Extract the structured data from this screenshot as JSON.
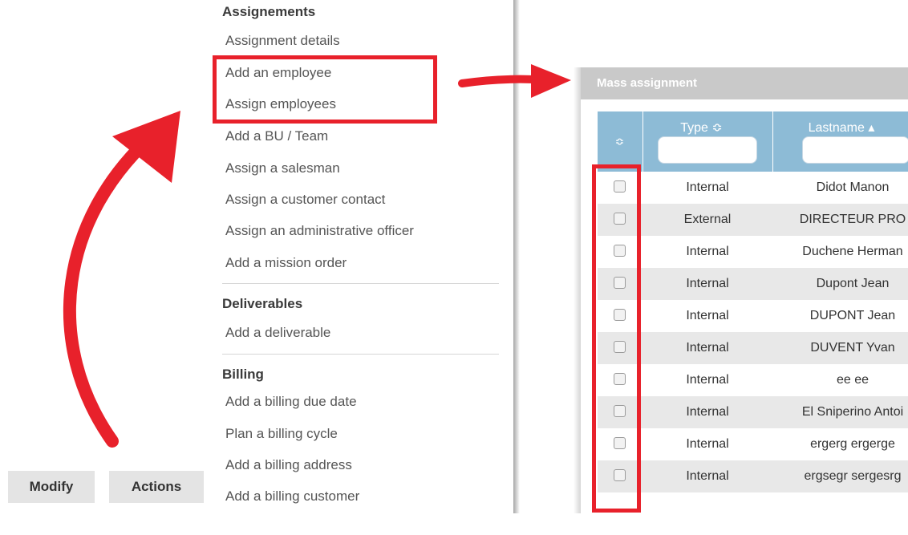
{
  "menu": {
    "sections": [
      {
        "title": "Assignements",
        "items": [
          "Assignment details",
          "Add an employee",
          "Assign employees",
          "Add a BU / Team",
          "Assign a salesman",
          "Assign a customer contact",
          "Assign an administrative officer",
          "Add a mission order"
        ]
      },
      {
        "title": "Deliverables",
        "items": [
          "Add a deliverable"
        ]
      },
      {
        "title": "Billing",
        "items": [
          "Add a billing due date",
          "Plan a billing cycle",
          "Add a billing address",
          "Add a billing customer"
        ]
      }
    ]
  },
  "buttons": {
    "modify": "Modify",
    "actions": "Actions"
  },
  "panel": {
    "title": "Mass assignment",
    "columns": {
      "sort": "≎",
      "type": "Type ≎",
      "lastname": "Lastname ▴"
    },
    "rows": [
      {
        "type": "Internal",
        "lastname": "Didot Manon"
      },
      {
        "type": "External",
        "lastname": "DIRECTEUR PRO"
      },
      {
        "type": "Internal",
        "lastname": "Duchene Herman"
      },
      {
        "type": "Internal",
        "lastname": "Dupont Jean"
      },
      {
        "type": "Internal",
        "lastname": "DUPONT Jean"
      },
      {
        "type": "Internal",
        "lastname": "DUVENT Yvan"
      },
      {
        "type": "Internal",
        "lastname": "ee ee"
      },
      {
        "type": "Internal",
        "lastname": "El Sniperino Antoi"
      },
      {
        "type": "Internal",
        "lastname": "ergerg ergerge"
      },
      {
        "type": "Internal",
        "lastname": "ergsegr sergesrg"
      }
    ]
  },
  "colors": {
    "annotation_red": "#e8212b",
    "table_header": "#8dbbd6",
    "panel_title_bg": "#c9c9c9"
  }
}
